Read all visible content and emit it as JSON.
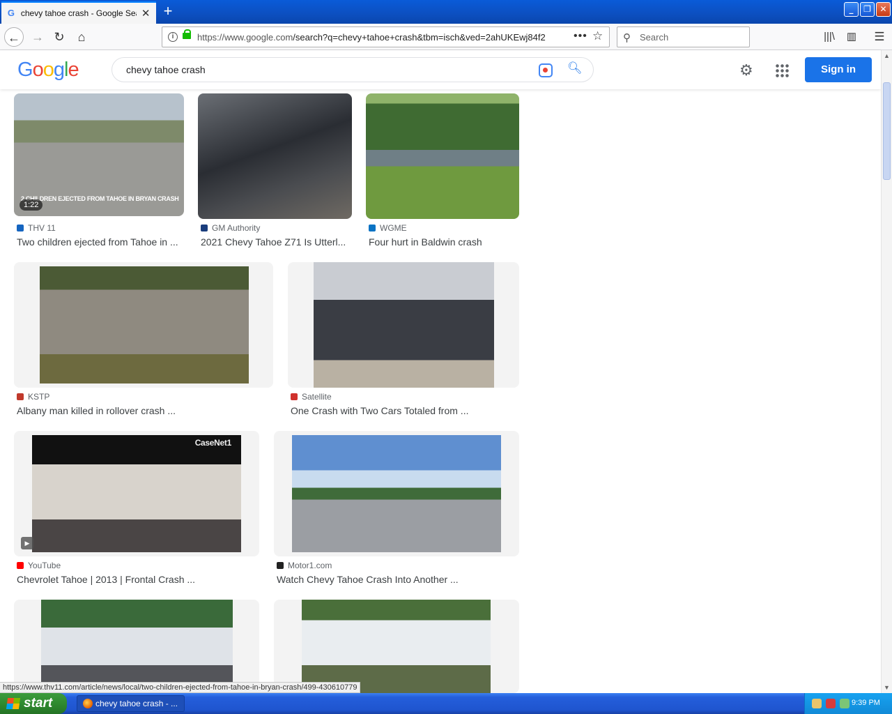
{
  "browser": {
    "tab_title": "chevy tahoe crash - Google Search",
    "new_tab": "+",
    "url_domain": "https://www.google.com",
    "url_path": "/search?q=chevy+tahoe+crash&tbm=isch&ved=2ahUKEwj84f2",
    "url_more": "•••",
    "search_placeholder": "Search"
  },
  "google": {
    "logo_letters": [
      "G",
      "o",
      "o",
      "g",
      "l",
      "e"
    ],
    "logo_colors": [
      "#4285f4",
      "#ea4335",
      "#fbbc05",
      "#4285f4",
      "#34a853",
      "#ea4335"
    ],
    "query": "chevy tahoe crash",
    "sign_in": "Sign in"
  },
  "results": [
    {
      "source": "THV 11",
      "caption": "Two children ejected from Tahoe in ...",
      "source_color": "#1565c0",
      "duration": "1:22",
      "overlay": "2 CHILDREN EJECTED FROM TAHOE IN BRYAN CRASH"
    },
    {
      "source": "GM Authority",
      "caption": "2021 Chevy Tahoe Z71 Is Utterl...",
      "source_color": "#1a3d7c"
    },
    {
      "source": "WGME",
      "caption": "Four hurt in Baldwin crash",
      "source_color": "#0a73c4"
    },
    {
      "source": "KSTP",
      "caption": "Albany man killed in rollover crash ...",
      "source_color": "#c0392b"
    },
    {
      "source": "Satellite",
      "caption": "One Crash with Two Cars Totaled from ...",
      "source_color": "#d0312d"
    },
    {
      "source": "YouTube",
      "caption": "Chevrolet Tahoe | 2013 | Frontal Crash ...",
      "source_color": "#ff0000",
      "overlay": "CaseNet1"
    },
    {
      "source": "Motor1.com",
      "caption": "Watch Chevy Tahoe Crash Into Another ...",
      "source_color": "#222222"
    },
    {
      "source": "",
      "caption": "",
      "source_color": "#999999"
    },
    {
      "source": "",
      "caption": "",
      "source_color": "#999999"
    }
  ],
  "status_url": "https://www.thv11.com/article/news/local/two-children-ejected-from-tahoe-in-bryan-crash/499-430610779",
  "taskbar": {
    "start": "start",
    "task_title": "chevy tahoe crash - ...",
    "clock": "9:39 PM"
  }
}
